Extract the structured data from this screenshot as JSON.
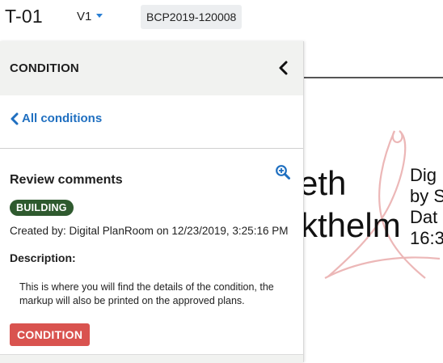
{
  "topbar": {
    "sheet_id": "T-01",
    "version": "V1",
    "doc_number": "BCP2019-120008"
  },
  "panel": {
    "title": "CONDITION",
    "back_link": "All conditions",
    "card": {
      "title": "Review comments",
      "discipline_badge": "BUILDING",
      "created_by": "Created by: Digital PlanRoom on 12/23/2019, 3:25:16 PM",
      "description_label": "Description:",
      "description": "This is where you will find the details of the condition, the markup will also be printed on the approved plans.",
      "type_badge": "CONDITION"
    }
  },
  "viewer": {
    "stamp_lines": [
      "Dig",
      "by S",
      "Dat",
      "16:3"
    ],
    "name_fragments": [
      "eth",
      "kthelm"
    ]
  },
  "colors": {
    "link": "#1f6fc0",
    "building_badge": "#2f5a2f",
    "condition_badge": "#d9534f",
    "panel_header": "#f1f2f0",
    "pdf_logo": "#e6a0a0"
  },
  "icons": {
    "version_caret": "caret-down-icon",
    "collapse": "chevron-left-icon",
    "back": "chevron-left-icon",
    "zoom": "zoom-in-icon"
  }
}
